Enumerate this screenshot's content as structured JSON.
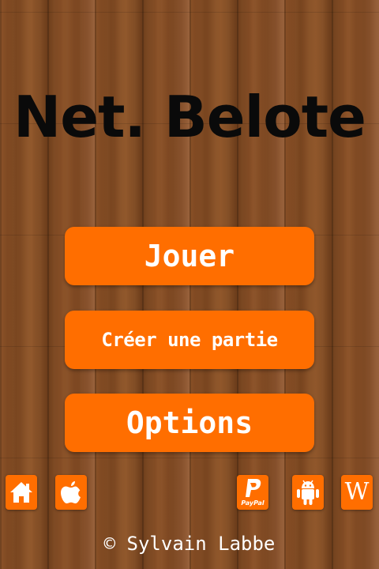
{
  "title": "Net. Belote",
  "menu": {
    "play_label": "Jouer",
    "create_label": "Créer une partie",
    "options_label": "Options"
  },
  "footer_icons": {
    "home": "home-icon",
    "apple": "apple-icon",
    "paypal": "paypal-icon",
    "paypal_text": "PayPal",
    "android": "android-icon",
    "wikipedia": "wikipedia-icon",
    "wikipedia_glyph": "W"
  },
  "copyright": "© Sylvain Labbe",
  "colors": {
    "accent": "#ff6e00",
    "title": "#0a0a0a",
    "button_text": "#ffffff",
    "background_wood": "#7a4722"
  }
}
